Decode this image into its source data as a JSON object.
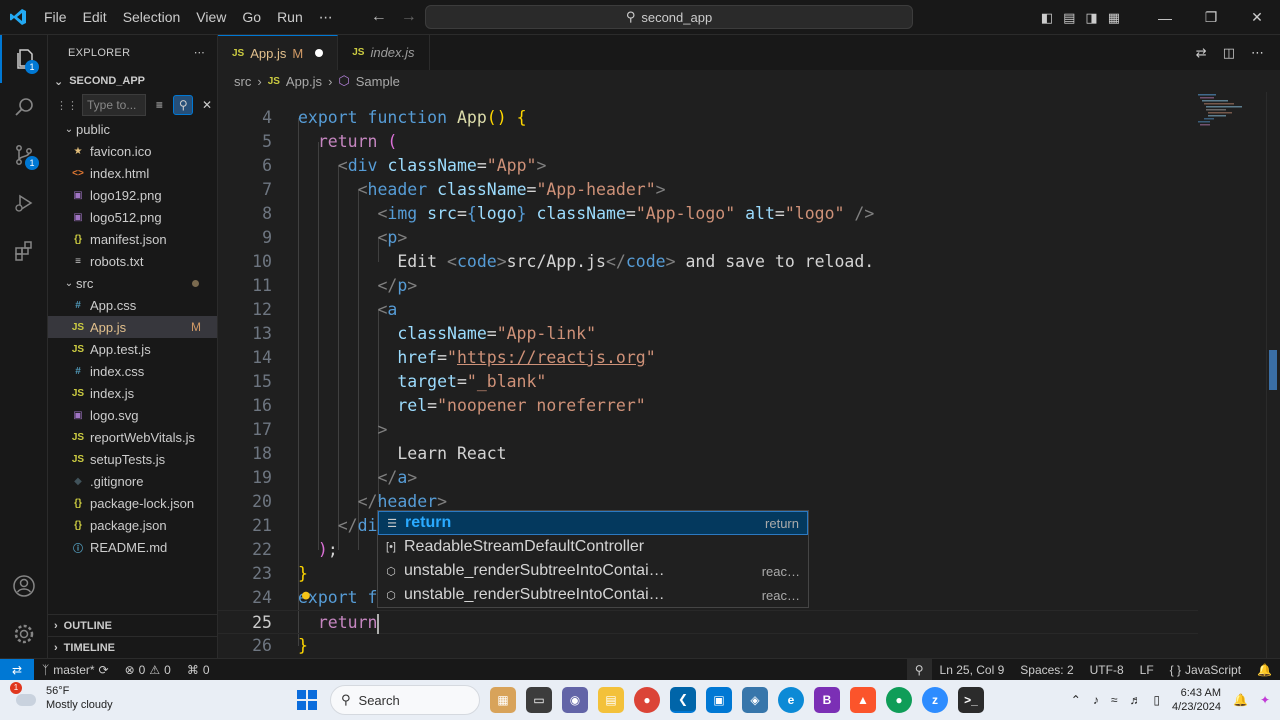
{
  "titlebar": {
    "menus": [
      "File",
      "Edit",
      "Selection",
      "View",
      "Go",
      "Run",
      "⋯"
    ],
    "search": "second_app"
  },
  "explorer": {
    "title": "EXPLORER",
    "project": "SECOND_APP",
    "filter_placeholder": "Type to...",
    "items": [
      {
        "label": "public",
        "type": "folder"
      },
      {
        "label": "favicon.ico",
        "icon": "★",
        "color": "#e5c07b"
      },
      {
        "label": "index.html",
        "icon": "<>",
        "color": "#e37933"
      },
      {
        "label": "logo192.png",
        "icon": "▣",
        "color": "#a074c4"
      },
      {
        "label": "logo512.png",
        "icon": "▣",
        "color": "#a074c4"
      },
      {
        "label": "manifest.json",
        "icon": "{}",
        "color": "#cbcb41"
      },
      {
        "label": "robots.txt",
        "icon": "≡",
        "color": "#cccccc"
      },
      {
        "label": "src",
        "type": "folder"
      },
      {
        "label": "App.css",
        "icon": "#",
        "color": "#519aba"
      },
      {
        "label": "App.js",
        "icon": "JS",
        "color": "#cbcb41",
        "modified": "M"
      },
      {
        "label": "App.test.js",
        "icon": "JS",
        "color": "#cbcb41"
      },
      {
        "label": "index.css",
        "icon": "#",
        "color": "#519aba"
      },
      {
        "label": "index.js",
        "icon": "JS",
        "color": "#cbcb41"
      },
      {
        "label": "logo.svg",
        "icon": "▣",
        "color": "#a074c4"
      },
      {
        "label": "reportWebVitals.js",
        "icon": "JS",
        "color": "#cbcb41"
      },
      {
        "label": "setupTests.js",
        "icon": "JS",
        "color": "#cbcb41"
      },
      {
        "label": ".gitignore",
        "icon": "◆",
        "color": "#41535b"
      },
      {
        "label": "package-lock.json",
        "icon": "{}",
        "color": "#cbcb41"
      },
      {
        "label": "package.json",
        "icon": "{}",
        "color": "#cbcb41"
      },
      {
        "label": "README.md",
        "icon": "ⓘ",
        "color": "#519aba"
      }
    ],
    "outline": "OUTLINE",
    "timeline": "TIMELINE"
  },
  "tabs": [
    {
      "label": "App.js",
      "modified": "M"
    },
    {
      "label": "index.js"
    }
  ],
  "breadcrumb": [
    "src",
    "App.js",
    "Sample"
  ],
  "code_lines": [
    4,
    5,
    6,
    7,
    8,
    9,
    10,
    11,
    12,
    13,
    14,
    15,
    16,
    17,
    18,
    19,
    20,
    21,
    22,
    23,
    24,
    25,
    26
  ],
  "suggest": [
    {
      "icon": "☰",
      "label": "return",
      "detail": "return"
    },
    {
      "icon": "[•]",
      "label": "ReadableStreamDefaultController",
      "detail": ""
    },
    {
      "icon": "⬡",
      "label": "unstable_renderSubtreeIntoContai…",
      "detail": "reac…"
    },
    {
      "icon": "⬡",
      "label": "unstable_renderSubtreeIntoContai…",
      "detail": "reac…"
    }
  ],
  "status": {
    "branch": "master*",
    "errors": "0",
    "warnings": "0",
    "ports": "0",
    "position": "Ln 25, Col 9",
    "spaces": "Spaces: 2",
    "encoding": "UTF-8",
    "eol": "LF",
    "language": "JavaScript"
  },
  "taskbar": {
    "temp": "56°F",
    "weather": "Mostly cloudy",
    "search": "Search",
    "time": "6:43 AM",
    "date": "4/23/2024"
  },
  "colors": {
    "accent": "#0078d4",
    "vscode_blue": "#23a9f2"
  }
}
